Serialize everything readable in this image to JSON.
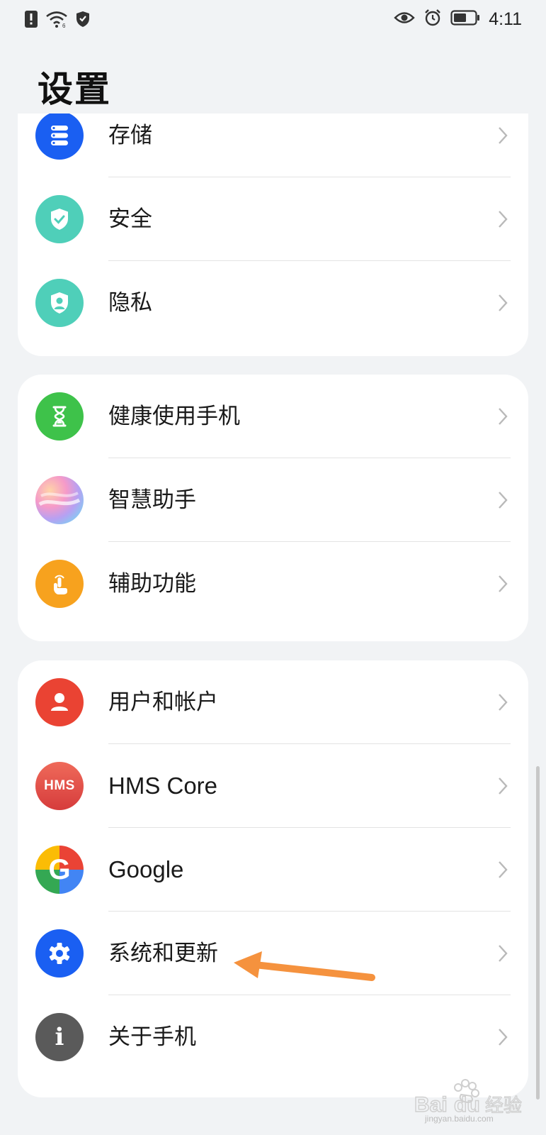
{
  "status_bar": {
    "time": "4:11",
    "icons": [
      "notification-alert-icon",
      "wifi-icon",
      "shield-icon",
      "eye-comfort-icon",
      "alarm-icon",
      "battery-icon"
    ]
  },
  "page": {
    "title": "设置"
  },
  "groups": [
    {
      "items": [
        {
          "label": "存储",
          "icon": "storage-icon",
          "color": "#1a5ff2"
        },
        {
          "label": "安全",
          "icon": "security-shield-icon",
          "color": "#4fcfb9"
        },
        {
          "label": "隐私",
          "icon": "privacy-icon",
          "color": "#4fcfb9"
        }
      ]
    },
    {
      "items": [
        {
          "label": "健康使用手机",
          "icon": "hourglass-icon",
          "color": "#3ec24a"
        },
        {
          "label": "智慧助手",
          "icon": "assistant-icon",
          "color": "#e88fc6"
        },
        {
          "label": "辅助功能",
          "icon": "accessibility-hand-icon",
          "color": "#f7a21e"
        }
      ]
    },
    {
      "items": [
        {
          "label": "用户和帐户",
          "icon": "user-icon",
          "color": "#ea4333"
        },
        {
          "label": "HMS Core",
          "icon": "hms-icon",
          "icon_text": "HMS",
          "color": "#e04f4f"
        },
        {
          "label": "Google",
          "icon": "google-icon",
          "icon_text": "G",
          "color": "#4285f4"
        },
        {
          "label": "系统和更新",
          "icon": "gear-icon",
          "color": "#1a5ff2"
        },
        {
          "label": "关于手机",
          "icon": "info-icon",
          "icon_text": "i",
          "color": "#5a5a5a"
        }
      ]
    }
  ],
  "annotation_color": "#f5923e",
  "watermark": {
    "brand": "Bai du 经验",
    "url": "jingyan.baidu.com"
  }
}
